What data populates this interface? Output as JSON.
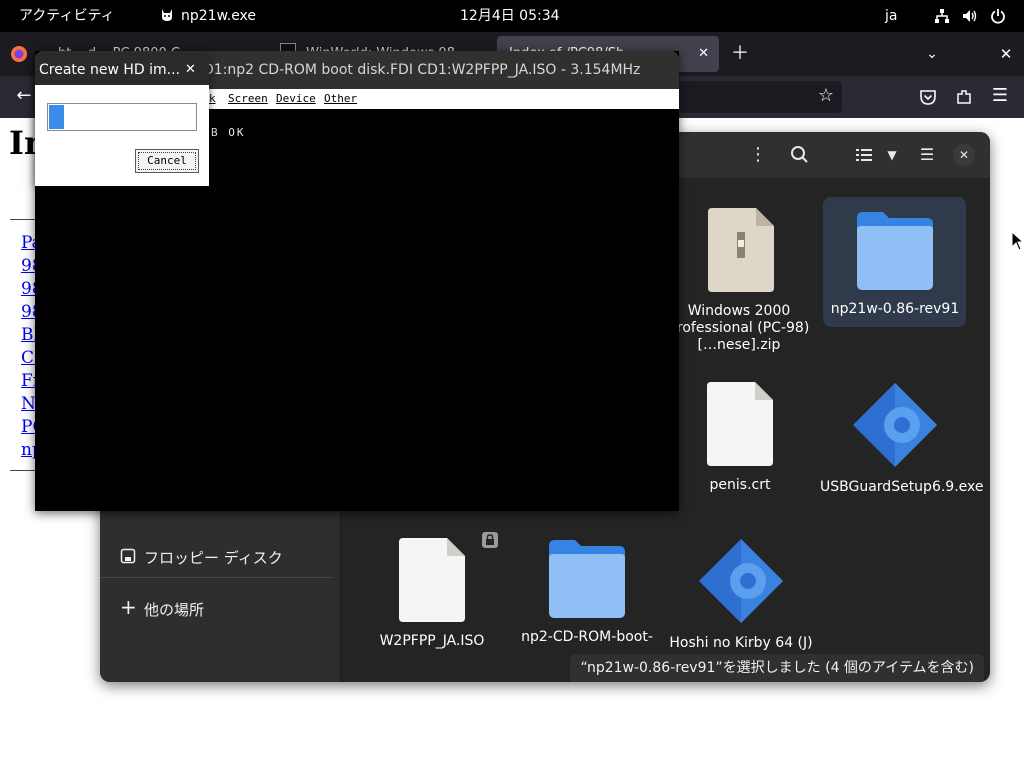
{
  "topbar": {
    "activities": "アクティビティ",
    "app_name": "np21w.exe",
    "clock": "12月4日  05:34",
    "input_method": "ja"
  },
  "firefox": {
    "tabs": [
      {
        "title": "ht....d... PC 9800 C..."
      },
      {
        "title": "WinWorld: Windows 98..."
      },
      {
        "title": "Index of /PC98/Sh..."
      }
    ],
    "page": {
      "heading": "In",
      "links": [
        "Pa",
        "98",
        "98",
        "98",
        "BI",
        "CI",
        "Fr",
        "N",
        "PC",
        "np"
      ]
    }
  },
  "files": {
    "sidebar": [
      {
        "label": "…"
      },
      {
        "label": "フロッピー ディスク"
      },
      {
        "label": "他の場所"
      }
    ],
    "items": [
      {
        "label": "Windows 2000 Professional (PC-98) […nese].zip",
        "icon": "zip-archive"
      },
      {
        "label": "np21w-0.86-rev91",
        "icon": "folder",
        "selected": true
      },
      {
        "label": "penis.crt",
        "icon": "text-file"
      },
      {
        "label": "USBGuardSetup6.9.exe",
        "icon": "exe"
      },
      {
        "label": "W2PFPP_JA.ISO",
        "icon": "text-file",
        "locked": true
      },
      {
        "label": "np2-CD-ROM-boot-",
        "icon": "folder"
      },
      {
        "label": "Hoshi no Kirby 64 (J)",
        "icon": "exe"
      }
    ],
    "status": "“np21w-0.86-rev91”を選択しました (4 個のアイテムを含む)"
  },
  "np2": {
    "title": "D1:np2 CD-ROM boot disk.FDI  CD1:W2PFPP_JA.ISO - 3.154MHz",
    "menu": [
      "k",
      "Screen",
      "Device",
      "Other"
    ],
    "screen_text": "B OK"
  },
  "hd_dialog": {
    "title": "Create new HD im...",
    "progress": 0.1,
    "cancel_label": "Cancel"
  },
  "colors": {
    "accent": "#3584e4",
    "progress": "#3b8bea",
    "files_bg": "#242424",
    "topbar_bg": "#000000"
  }
}
